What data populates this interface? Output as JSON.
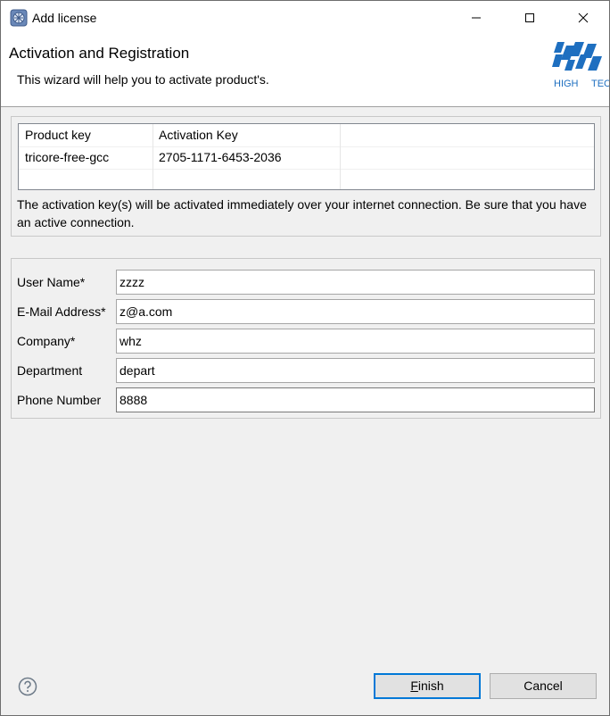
{
  "window": {
    "title": "Add license"
  },
  "header": {
    "title": "Activation and Registration",
    "description": "This wizard will help you to activate product's.",
    "logo_text_left": "HIGH",
    "logo_text_right": "TEC"
  },
  "license_table": {
    "columns": [
      "Product key",
      "Activation Key"
    ],
    "rows": [
      [
        "tricore-free-gcc",
        "2705-1171-6453-2036"
      ]
    ]
  },
  "note": "The activation key(s) will be activated immediately over your internet connection. Be sure that you have an active connection.",
  "form": {
    "fields": [
      {
        "label": "User Name*",
        "value": "zzzz"
      },
      {
        "label": "E-Mail Address*",
        "value": "z@a.com"
      },
      {
        "label": "Company*",
        "value": "whz"
      },
      {
        "label": "Department",
        "value": "depart"
      },
      {
        "label": "Phone Number",
        "value": "8888"
      }
    ]
  },
  "buttons": {
    "finish_label_mnemonic": "F",
    "finish_label_rest": "inish",
    "cancel_label": "Cancel"
  },
  "colors": {
    "accent": "#0078d7",
    "logo_blue": "#1e6fc0"
  }
}
